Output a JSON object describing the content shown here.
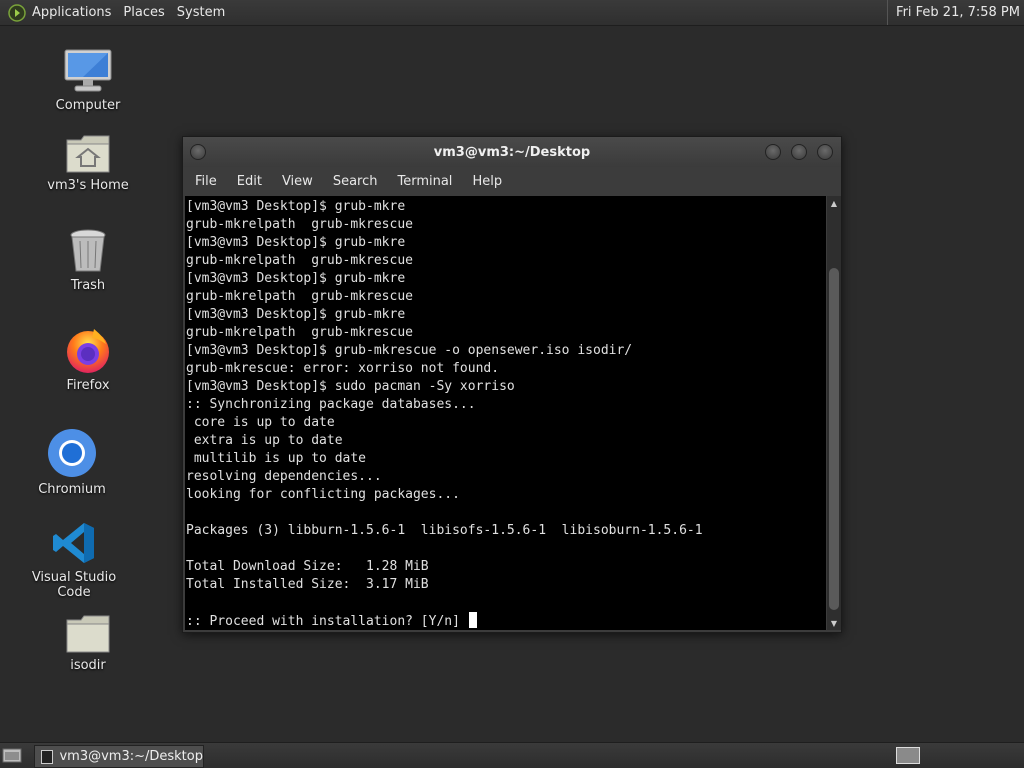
{
  "top_panel": {
    "menus": [
      "Applications",
      "Places",
      "System"
    ],
    "clock": "Fri Feb 21,  7:58 PM"
  },
  "desktop_icons": [
    {
      "label": "Computer",
      "icon": "computer-icon"
    },
    {
      "label": "vm3's Home",
      "icon": "home-folder-icon"
    },
    {
      "label": "Trash",
      "icon": "trash-icon"
    },
    {
      "label": "Firefox",
      "icon": "firefox-icon"
    },
    {
      "label": "Chromium",
      "icon": "chromium-icon"
    },
    {
      "label": "Visual Studio Code",
      "icon": "vscode-icon"
    },
    {
      "label": "isodir",
      "icon": "folder-icon"
    }
  ],
  "terminal": {
    "title": "vm3@vm3:~/Desktop",
    "menu": [
      "File",
      "Edit",
      "View",
      "Search",
      "Terminal",
      "Help"
    ],
    "lines": [
      "[vm3@vm3 Desktop]$ grub-mkre",
      "grub-mkrelpath  grub-mkrescue",
      "[vm3@vm3 Desktop]$ grub-mkre",
      "grub-mkrelpath  grub-mkrescue",
      "[vm3@vm3 Desktop]$ grub-mkre",
      "grub-mkrelpath  grub-mkrescue",
      "[vm3@vm3 Desktop]$ grub-mkre",
      "grub-mkrelpath  grub-mkrescue",
      "[vm3@vm3 Desktop]$ grub-mkrescue -o opensewer.iso isodir/",
      "grub-mkrescue: error: xorriso not found.",
      "[vm3@vm3 Desktop]$ sudo pacman -Sy xorriso",
      ":: Synchronizing package databases...",
      " core is up to date",
      " extra is up to date",
      " multilib is up to date",
      "resolving dependencies...",
      "looking for conflicting packages...",
      "",
      "Packages (3) libburn-1.5.6-1  libisofs-1.5.6-1  libisoburn-1.5.6-1",
      "",
      "Total Download Size:   1.28 MiB",
      "Total Installed Size:  3.17 MiB",
      "",
      ":: Proceed with installation? [Y/n] "
    ]
  },
  "taskbar": {
    "window_button": "vm3@vm3:~/Desktop"
  }
}
